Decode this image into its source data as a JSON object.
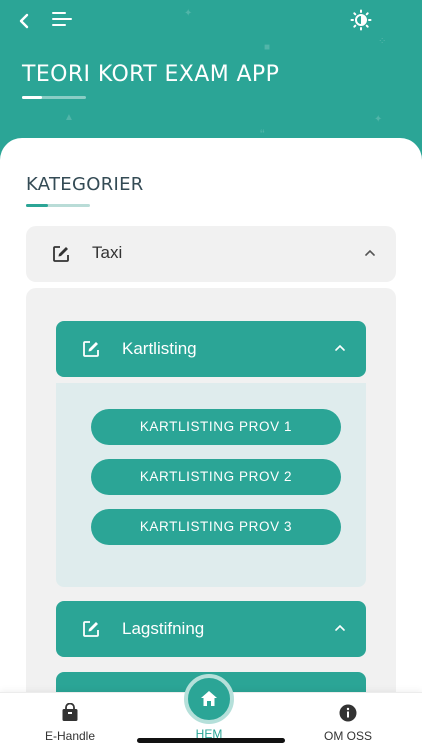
{
  "header": {
    "app_title": "TEORI KORT EXAM APP",
    "back_icon": "back-chevron-icon",
    "menu_icon": "menu-icon",
    "theme_icon": "brightness-icon"
  },
  "colors": {
    "primary": "#2ba596",
    "primary_light": "#dfeced",
    "row_bg": "#f1f1f1",
    "text_dark": "#344b55"
  },
  "section": {
    "title": "KATEGORIER"
  },
  "category": {
    "label": "Taxi",
    "icon": "edit-icon",
    "chevron": "chevron-up-icon",
    "subcategories": [
      {
        "label": "Kartlisting",
        "icon": "edit-icon",
        "chevron": "chevron-up-icon",
        "tests": [
          "KARTLISTING PROV 1",
          "KARTLISTING PROV 2",
          "KARTLISTING PROV 3"
        ]
      },
      {
        "label": "Lagstifning",
        "icon": "edit-icon",
        "chevron": "chevron-up-icon"
      }
    ]
  },
  "bottom_nav": {
    "shop_label": "E-Handle",
    "home_label": "HEM",
    "about_label": "OM OSS",
    "shop_icon": "shopping-bag-icon",
    "home_icon": "home-icon",
    "about_icon": "info-icon"
  }
}
